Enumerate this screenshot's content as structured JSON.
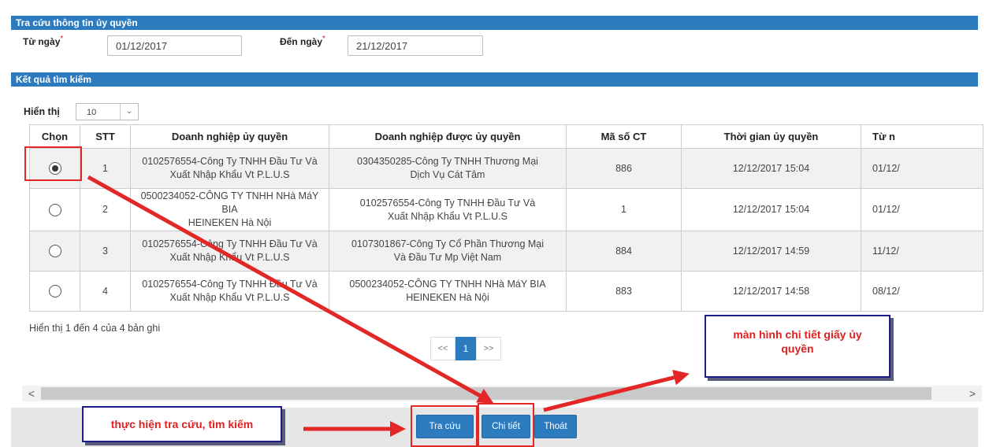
{
  "search_panel": {
    "title": "Tra cứu thông tin ủy quyền",
    "from_label": "Từ ngày",
    "from_value": "01/12/2017",
    "to_label": "Đến ngày",
    "to_value": "21/12/2017",
    "required_mark": "*"
  },
  "results_panel": {
    "title": "Kết quả tìm kiếm",
    "show_label": "Hiển thị",
    "page_size": "10"
  },
  "table": {
    "headers": [
      "Chọn",
      "STT",
      "Doanh nghiệp ủy quyền",
      "Doanh nghiệp được ủy quyền",
      "Mã số CT",
      "Thời gian ủy quyền",
      "Từ n"
    ],
    "rows": [
      {
        "selected": true,
        "stt": "1",
        "grantor_line1": "0102576554-Công Ty TNHH Đầu Tư Và",
        "grantor_line2": "Xuất Nhập Khẩu Vt P.L.U.S",
        "grantee_line1": "0304350285-Công Ty TNHH Thương Mại",
        "grantee_line2": "Dịch Vụ Cát Tâm",
        "code": "886",
        "time": "12/12/2017 15:04",
        "from": "01/12/"
      },
      {
        "selected": false,
        "stt": "2",
        "grantor_line1": "0500234052-CÔNG TY TNHH NHà MáY BIA",
        "grantor_line2": "HEINEKEN Hà Nội",
        "grantee_line1": "0102576554-Công Ty TNHH Đầu Tư Và",
        "grantee_line2": "Xuất Nhập Khẩu Vt P.L.U.S",
        "code": "1",
        "time": "12/12/2017 15:04",
        "from": "01/12/"
      },
      {
        "selected": false,
        "stt": "3",
        "grantor_line1": "0102576554-Công Ty TNHH Đầu Tư Và",
        "grantor_line2": "Xuất Nhập Khẩu Vt P.L.U.S",
        "grantee_line1": "0107301867-Công Ty Cổ Phần Thương Mại",
        "grantee_line2": "Và Đầu Tư Mp Việt Nam",
        "code": "884",
        "time": "12/12/2017 14:59",
        "from": "11/12/"
      },
      {
        "selected": false,
        "stt": "4",
        "grantor_line1": "0102576554-Công Ty TNHH Đầu Tư Và",
        "grantor_line2": "Xuất Nhập Khẩu Vt P.L.U.S",
        "grantee_line1": "0500234052-CÔNG TY TNHH NHà MáY BIA",
        "grantee_line2": "HEINEKEN Hà Nội",
        "code": "883",
        "time": "12/12/2017 14:58",
        "from": "08/12/"
      }
    ]
  },
  "summary": "Hiển thị 1 đến 4 của 4 bản ghi",
  "pagination": {
    "prev": "<<",
    "current": "1",
    "next": ">>"
  },
  "scrollbar": {
    "left": "<",
    "right": ">"
  },
  "buttons": {
    "search": "Tra cứu",
    "detail": "Chi tiết",
    "exit": "Thoát"
  },
  "callouts": {
    "search_note": "thực hiện tra cứu, tìm kiếm",
    "detail_note_line1": "màn hình chi tiết giấy ủy",
    "detail_note_line2": "quyền"
  },
  "colors": {
    "header_bar": "#2c7bbf",
    "annotation_red": "#e32626",
    "callout_border": "#1b1b8a"
  }
}
